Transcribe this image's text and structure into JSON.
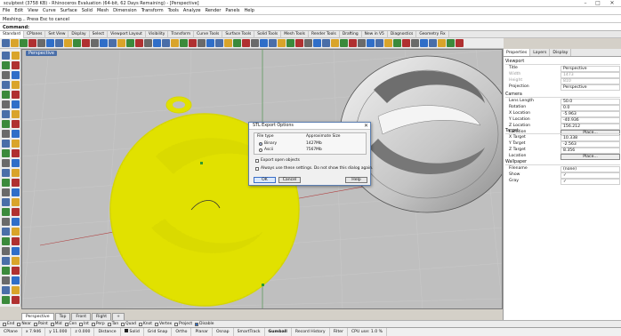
{
  "window": {
    "title": "sculptest (3758 KB) - Rhinoceros Evaluation (64-bit, 62 Days Remaining) - [Perspective]",
    "controls": [
      "–",
      "□",
      "✕"
    ]
  },
  "menu": [
    "File",
    "Edit",
    "View",
    "Curve",
    "Surface",
    "Solid",
    "Mesh",
    "Dimension",
    "Transform",
    "Tools",
    "Analyze",
    "Render",
    "Panels",
    "Help"
  ],
  "history": "Meshing... Press Esc to cancel",
  "command": {
    "label": "Command:",
    "value": ""
  },
  "toolbar_tabs": {
    "items": [
      "Standard",
      "CPlanes",
      "Set View",
      "Display",
      "Select",
      "Viewport Layout",
      "Visibility",
      "Transform",
      "Curve Tools",
      "Surface Tools",
      "Solid Tools",
      "Mesh Tools",
      "Render Tools",
      "Drafting",
      "New in V5",
      "Diagnostics",
      "Geometry Fix"
    ],
    "active": "Standard"
  },
  "toolbar_icon_colors": [
    "#4a6ea8",
    "#d9a42a",
    "#3b8a3b",
    "#b03030",
    "#6a6a6a",
    "#2f6ec8"
  ],
  "viewport": {
    "label": "Perspective",
    "tabs": [
      "Perspective",
      "Top",
      "Front",
      "Right",
      "+"
    ],
    "active_tab": "Perspective",
    "colors": {
      "selected_mesh": "#f2f200",
      "shaded_object": "#dcdcdc",
      "grid": "#c9c9c9",
      "background": "#bfbfbf"
    }
  },
  "dialog": {
    "title": "STL Export Options",
    "file_type_header": "File type",
    "size_header": "Approximate Size",
    "options": [
      {
        "label": "Binary",
        "size": "1427Mb",
        "selected": true
      },
      {
        "label": "Ascii",
        "size": "7567Mb",
        "selected": false
      }
    ],
    "export_open": "Export open objects",
    "always_use": "Always use these settings. Do not show this dialog again.",
    "buttons": {
      "ok": "OK",
      "cancel": "Cancel",
      "help": "Help"
    }
  },
  "panel": {
    "tabs": [
      "Properties",
      "Layers",
      "Display"
    ],
    "active_tab": "Properties",
    "viewport_section": {
      "header": "Viewport",
      "rows": [
        {
          "k": "Title",
          "v": "Perspective",
          "dim": false
        },
        {
          "k": "Width",
          "v": "1473",
          "dim": true
        },
        {
          "k": "Height",
          "v": "810",
          "dim": true
        },
        {
          "k": "Projection",
          "v": "Perspective",
          "dim": false
        }
      ]
    },
    "camera_section": {
      "header": "Camera",
      "rows": [
        {
          "k": "Lens Length",
          "v": "50.0"
        },
        {
          "k": "Rotation",
          "v": "0.0"
        },
        {
          "k": "X Location",
          "v": "-5.963"
        },
        {
          "k": "Y Location",
          "v": "-40.936"
        },
        {
          "k": "Z Location",
          "v": "156.212"
        },
        {
          "k": "Location",
          "v": "Place..."
        }
      ]
    },
    "target_section": {
      "header": "Target",
      "rows": [
        {
          "k": "X Target",
          "v": "10.338"
        },
        {
          "k": "Y Target",
          "v": "-2.563"
        },
        {
          "k": "Z Target",
          "v": "8.356"
        },
        {
          "k": "Location",
          "v": "Place..."
        }
      ]
    },
    "wallpaper_section": {
      "header": "Wallpaper",
      "rows": [
        {
          "k": "Filename",
          "v": "(none)"
        },
        {
          "k": "Show",
          "v": "✓"
        },
        {
          "k": "Gray",
          "v": "✓"
        }
      ]
    }
  },
  "osnaps": [
    {
      "label": "End",
      "on": false
    },
    {
      "label": "Near",
      "on": false
    },
    {
      "label": "Point",
      "on": false
    },
    {
      "label": "Mid",
      "on": false
    },
    {
      "label": "Cen",
      "on": false
    },
    {
      "label": "Int",
      "on": false
    },
    {
      "label": "Perp",
      "on": false
    },
    {
      "label": "Tan",
      "on": false
    },
    {
      "label": "Quad",
      "on": false
    },
    {
      "label": "Knot",
      "on": false
    },
    {
      "label": "Vertex",
      "on": false
    },
    {
      "label": "Project",
      "on": false
    },
    {
      "label": "Disable",
      "on": true
    }
  ],
  "status": {
    "cplane": "CPlane",
    "x": "x 7.946",
    "y": "y 11.000",
    "z": "z 0.000",
    "distance": "Distance",
    "layer": "Solid",
    "toggles": [
      "Grid Snap",
      "Ortho",
      "Planar",
      "Osnap",
      "SmartTrack",
      "Gumball",
      "Record History",
      "Filter"
    ],
    "cpu": "CPU use: 1.0 %"
  }
}
